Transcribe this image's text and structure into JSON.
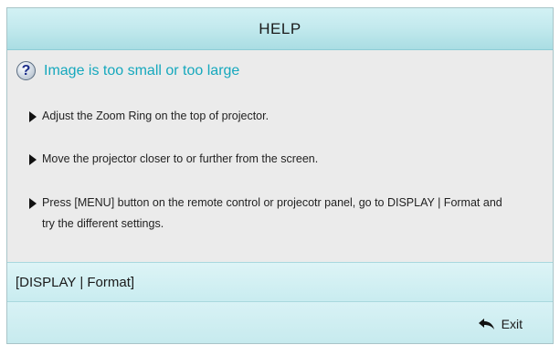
{
  "header": {
    "title": "HELP"
  },
  "topic": {
    "icon": "question-icon",
    "icon_glyph": "?",
    "title": "Image is too small or too large",
    "title_color": "#15a8bd"
  },
  "tips": [
    {
      "text": "Adjust the Zoom Ring on the top of projector."
    },
    {
      "text": "Move the projector closer to or further from the screen."
    },
    {
      "text": "Press [MENU] button on the remote control or projecotr panel, go to DISPLAY | Format and try the different settings."
    }
  ],
  "path": {
    "text": "[DISPLAY | Format]"
  },
  "footer": {
    "exit_label": "Exit",
    "exit_icon": "return-arrow-icon"
  },
  "colors": {
    "header_bg": "#c4eaee",
    "body_bg": "#ebebeb",
    "accent": "#15a8bd"
  }
}
